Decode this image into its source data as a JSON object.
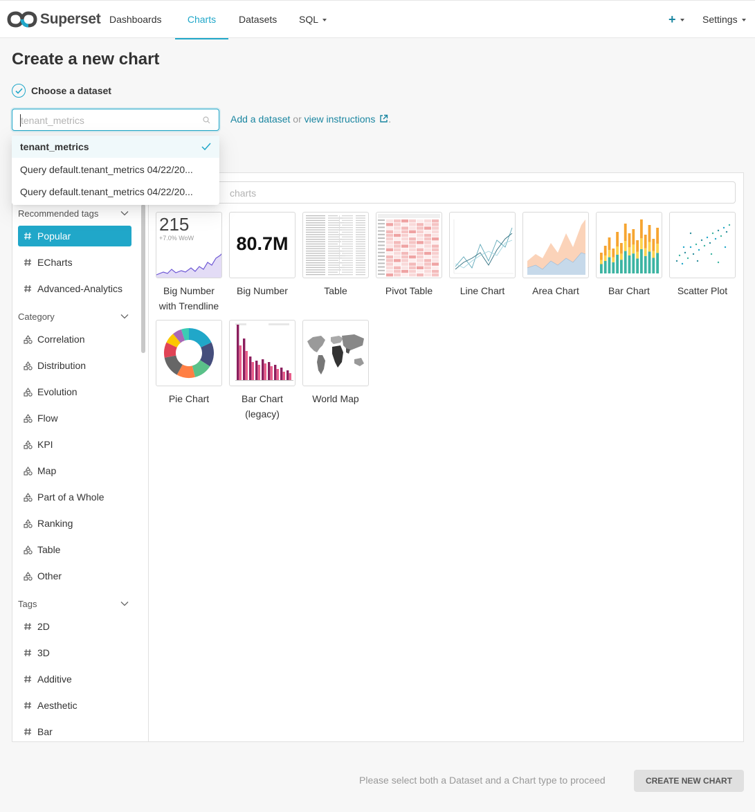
{
  "navbar": {
    "brand": "Superset",
    "items": [
      {
        "label": "Dashboards"
      },
      {
        "label": "Charts"
      },
      {
        "label": "Datasets"
      },
      {
        "label": "SQL"
      }
    ],
    "settings_label": "Settings",
    "accent_color": "#20a7c9"
  },
  "page": {
    "title": "Create a new chart",
    "step_label": "Choose a dataset"
  },
  "dataset_select": {
    "placeholder": "tenant_metrics",
    "options": [
      {
        "label": "tenant_metrics",
        "selected": true
      },
      {
        "label": "Query default.tenant_metrics 04/22/20..."
      },
      {
        "label": "Query default.tenant_metrics 04/22/20..."
      }
    ]
  },
  "help": {
    "add_dataset": "Add a dataset",
    "or": " or ",
    "view_instructions": "view instructions",
    "period": "."
  },
  "sidebar": {
    "recommended_header": "Recommended tags",
    "recommended": [
      {
        "label": "Popular",
        "active": true
      },
      {
        "label": "ECharts"
      },
      {
        "label": "Advanced-Analytics"
      }
    ],
    "category_header": "Category",
    "categories": [
      {
        "label": "Correlation"
      },
      {
        "label": "Distribution"
      },
      {
        "label": "Evolution"
      },
      {
        "label": "Flow"
      },
      {
        "label": "KPI"
      },
      {
        "label": "Map"
      },
      {
        "label": "Part of a Whole"
      },
      {
        "label": "Ranking"
      },
      {
        "label": "Table"
      },
      {
        "label": "Other"
      }
    ],
    "tags_header": "Tags",
    "tags": [
      {
        "label": "2D"
      },
      {
        "label": "3D"
      },
      {
        "label": "Additive"
      },
      {
        "label": "Aesthetic"
      },
      {
        "label": "Bar"
      }
    ]
  },
  "search": {
    "placeholder": "charts"
  },
  "charts": [
    {
      "label_line1": "Big Number",
      "label_line2": "with Trendline",
      "thumb_value": "215",
      "thumb_sub": "+7.0% WoW"
    },
    {
      "label_line1": "Big Number",
      "label_line2": "",
      "thumb_value": "80.7M"
    },
    {
      "label_line1": "Table",
      "label_line2": ""
    },
    {
      "label_line1": "Pivot Table",
      "label_line2": ""
    },
    {
      "label_line1": "Line Chart",
      "label_line2": ""
    },
    {
      "label_line1": "Area Chart",
      "label_line2": ""
    },
    {
      "label_line1": "Bar Chart",
      "label_line2": ""
    },
    {
      "label_line1": "Scatter Plot",
      "label_line2": ""
    },
    {
      "label_line1": "Pie Chart",
      "label_line2": ""
    },
    {
      "label_line1": "Bar Chart",
      "label_line2": "(legacy)"
    },
    {
      "label_line1": "World Map",
      "label_line2": ""
    }
  ],
  "footer": {
    "message": "Please select both a Dataset and a Chart type to proceed",
    "create_button": "CREATE NEW CHART"
  }
}
